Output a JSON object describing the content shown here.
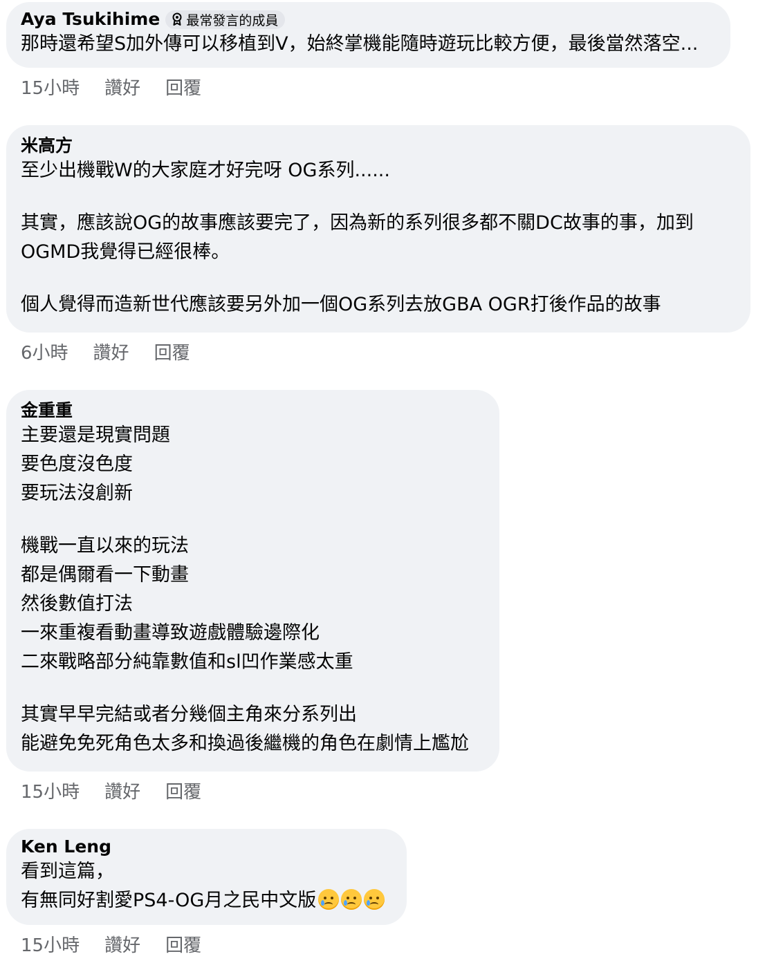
{
  "comments": [
    {
      "author": "Aya Tsukihime",
      "badge": "最常發言的成員",
      "lines": [
        "那時還希望S加外傳可以移植到V，始終掌機能隨時遊玩比較方便，最後當然落空..."
      ],
      "time": "15小時",
      "like": "讚好",
      "reply": "回覆"
    },
    {
      "author": "米高方",
      "lines": [
        "至少出機戰W的大家庭才好完呀 OG系列......",
        "",
        "其實，應該說OG的故事應該要完了，因為新的系列很多都不關DC故事的事，加到",
        "OGMD我覺得已經很棒。",
        "",
        "個人覺得而造新世代應該要另外加一個OG系列去放GBA OGR打後作品的故事"
      ],
      "time": "6小時",
      "like": "讚好",
      "reply": "回覆"
    },
    {
      "author": "金重重",
      "lines": [
        "主要還是現實問題",
        "要色度沒色度",
        "要玩法沒創新",
        "",
        "機戰一直以來的玩法",
        "都是偶爾看一下動畫",
        "然後數值打法",
        "一來重複看動畫導致遊戲體驗邊際化",
        "二來戰略部分純靠數值和sl凹作業感太重",
        "",
        "其實早早完結或者分幾個主角來分系列出",
        "能避免免死角色太多和換過後繼機的角色在劇情上尷尬"
      ],
      "time": "15小時",
      "like": "讚好",
      "reply": "回覆"
    },
    {
      "author": "Ken Leng",
      "lines": [
        "看到這篇，",
        "有無同好割愛PS4-OG月之民中文版"
      ],
      "emoji_count": 3,
      "emoji_name": "face-holding-back-tears-emoji",
      "time": "15小時",
      "like": "讚好",
      "reply": "回覆"
    }
  ]
}
